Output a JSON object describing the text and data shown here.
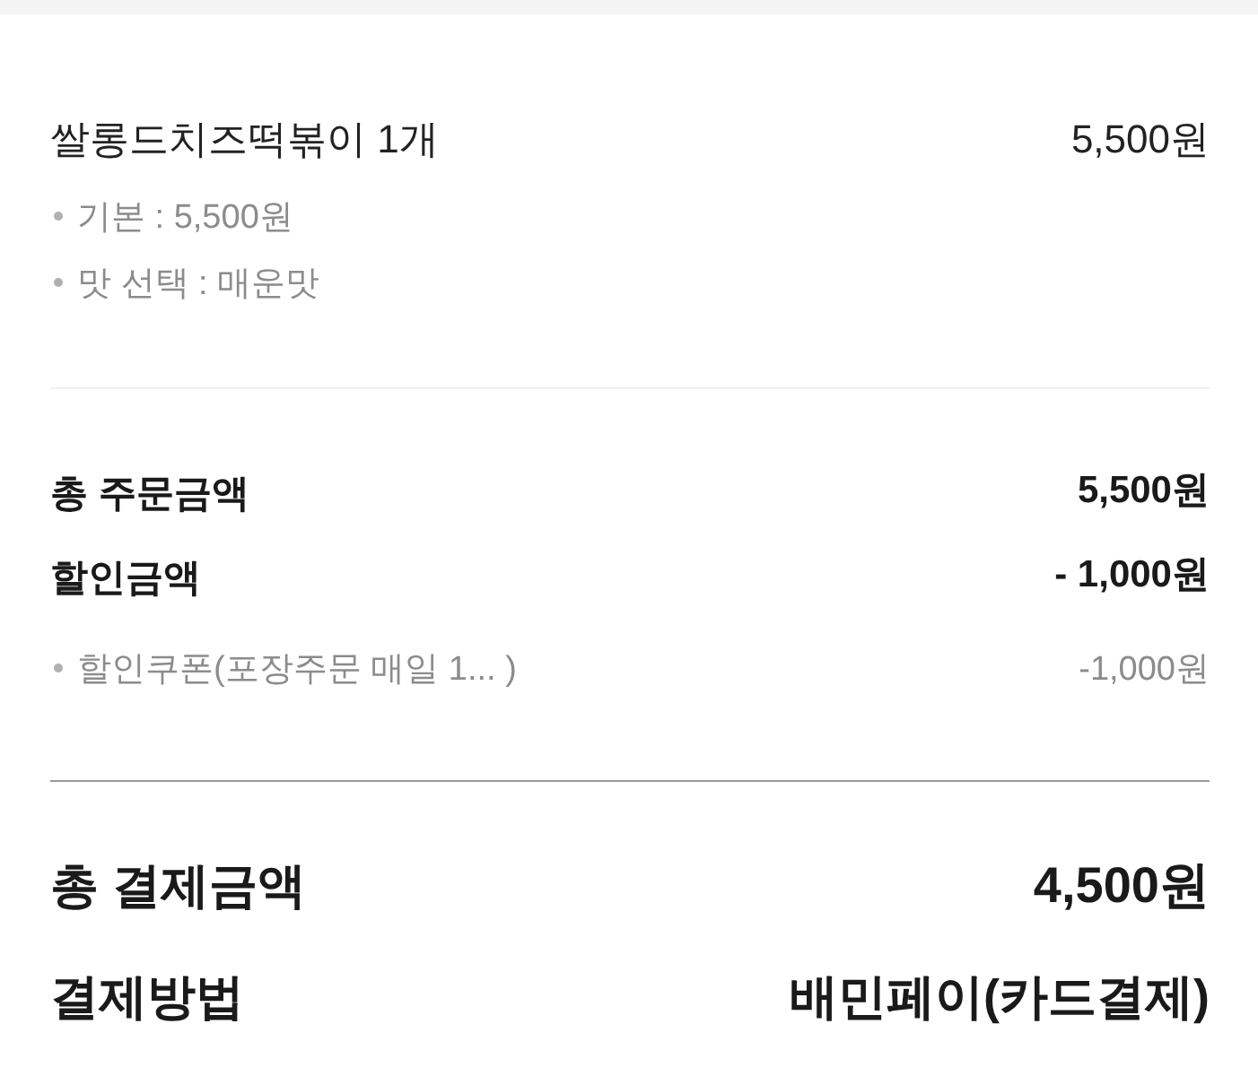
{
  "order_item": {
    "name": "쌀롱드치즈떡볶이 1개",
    "price": "5,500원",
    "options": [
      "기본 : 5,500원",
      "맛 선택 : 매운맛"
    ]
  },
  "summary": {
    "rows": [
      {
        "label": "총 주문금액",
        "value": "5,500원"
      },
      {
        "label": "할인금액",
        "value": "- 1,000원"
      }
    ],
    "details": [
      {
        "label": "할인쿠폰(포장주문 매일 1... )",
        "value": "-1,000원"
      }
    ]
  },
  "payment": {
    "rows": [
      {
        "kind": "total",
        "label": "총 결제금액",
        "value": "4,500원"
      },
      {
        "kind": "method",
        "label": "결제방법",
        "value": "배민페이(카드결제)"
      }
    ]
  }
}
